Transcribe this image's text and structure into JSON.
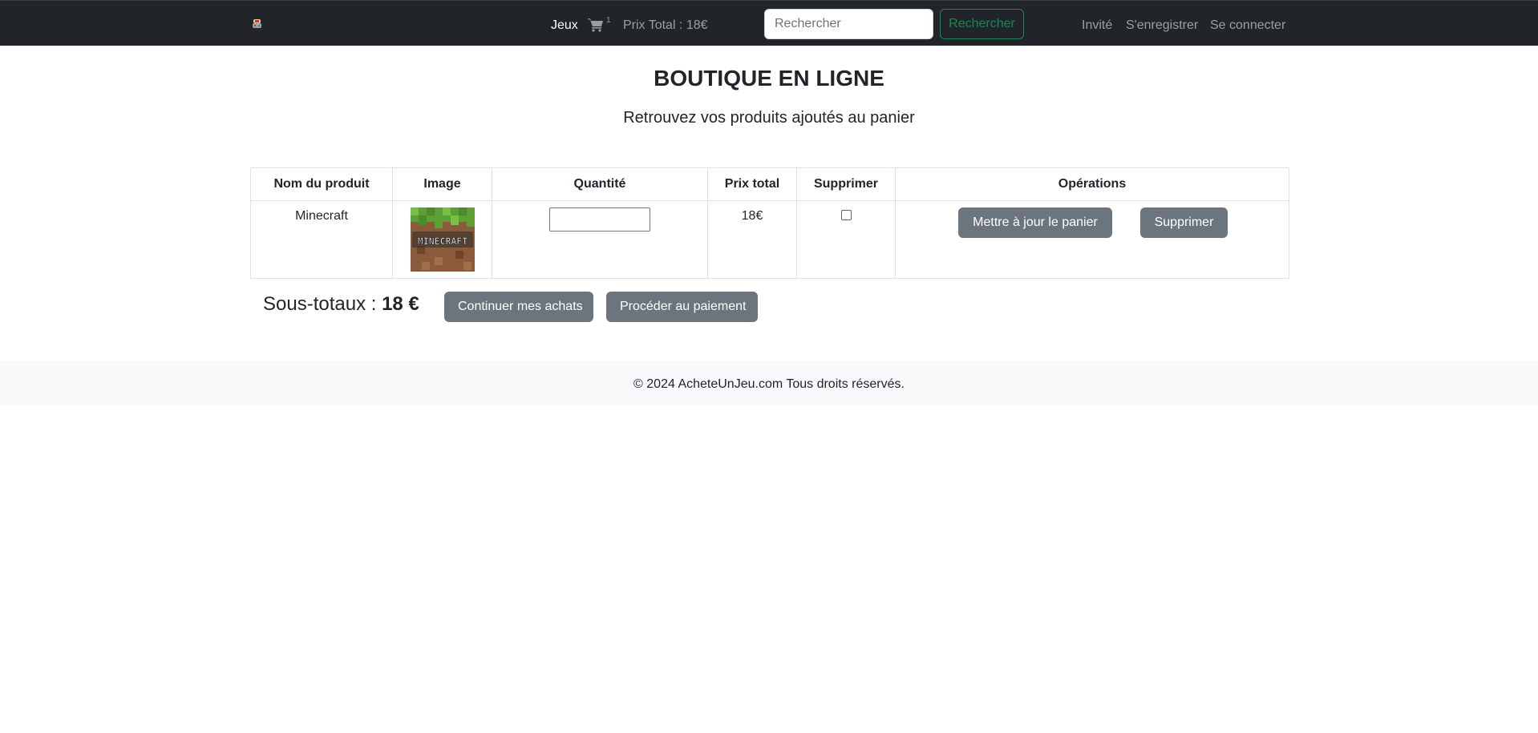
{
  "nav": {
    "logo_icon": "game-logo-icon",
    "games_link": "Jeux",
    "cart_icon": "shopping-cart-icon",
    "cart_count": "1",
    "total_price": "Prix Total : 18€",
    "search_placeholder": "Rechercher",
    "search_button": "Rechercher",
    "guest_link": "Invité",
    "register_link": "S'enregistrer",
    "login_link": "Se connecter",
    "colors": {
      "navbar_bg": "#212529",
      "search_button": "#198754"
    }
  },
  "header": {
    "title": "BOUTIQUE EN LIGNE",
    "subtitle": "Retrouvez vos produits ajoutés au panier"
  },
  "cart_table": {
    "columns": [
      "Nom du produit",
      "Image",
      "Quantité",
      "Prix total",
      "Supprimer",
      "Opérations"
    ],
    "rows": [
      {
        "product_name": "Minecraft",
        "image_text": "MINECRAFT",
        "quantity": "",
        "total_price": "18€",
        "remove_checked": false,
        "update_button": "Mettre à jour le panier",
        "delete_button": "Supprimer"
      }
    ]
  },
  "summary": {
    "subtotal_label": "Sous-totaux : ",
    "subtotal_value": "18 €",
    "continue_button": "Continuer mes achats",
    "checkout_button": "Procéder au paiement"
  },
  "footer": {
    "text": "© 2024 AcheteUnJeu.com Tous droits réservés."
  }
}
